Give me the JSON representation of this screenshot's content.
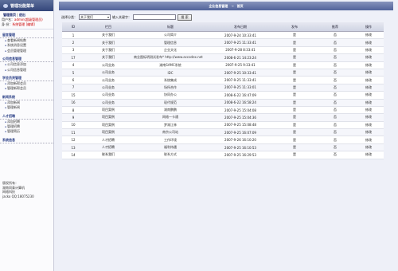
{
  "sidebar": {
    "title": "管理功能菜单",
    "top_links": [
      "管理首页",
      "退出"
    ],
    "user_label": "用户名：",
    "user_value": "admin(超级管理员)",
    "identity_label": "身 份：",
    "identity_value": "系统管理",
    "identity_extra": "[编辑]",
    "sections": [
      {
        "title": "留言管理",
        "items": [
          "查看新闻帖数",
          "系统消息设置",
          "会员管理管理"
        ]
      },
      {
        "title": "公司信息管理",
        "items": [
          "公司信息添加",
          "公司信息管理"
        ]
      },
      {
        "title": "学会员资管理",
        "items": [
          "添加新帮会员",
          "管理新帮会员"
        ]
      },
      {
        "title": "新闻系统",
        "items": [
          "添加新闻",
          "管理新闻"
        ]
      },
      {
        "title": "人才招聘",
        "items": [
          "添加招聘",
          "管理招聘",
          "管理简历"
        ]
      },
      {
        "title": "系统信息",
        "items": []
      }
    ],
    "footer": [
      "版权所有：",
      "湖南同泰计算机",
      "网络科技",
      "jacko QQ:18075230"
    ]
  },
  "header": {
    "title": "企业信息管理",
    "sep": "→",
    "current": "首页"
  },
  "search": {
    "label": "选择分类：",
    "category": "关于我们",
    "keyword_label": "输入关键字：",
    "keyword": "",
    "button": "搜 索"
  },
  "table": {
    "columns": [
      "ID",
      "栏目",
      "标题",
      "发布日期",
      "发布",
      "推荐",
      "操作"
    ],
    "rows": [
      [
        "1",
        "关于我们",
        "公司简介",
        "2007-9-24 10:33:41",
        "是",
        "否",
        "修改"
      ],
      [
        "2",
        "关于我们",
        "管理信息",
        "2007-9-25 11:33:41",
        "是",
        "否",
        "修改"
      ],
      [
        "3",
        "关于我们",
        "企业文化",
        "2007-9-28 8:33:41",
        "是",
        "否",
        "修改"
      ],
      [
        "17",
        "关于我们",
        "商业图标明测试发布* http://www.accodex.net",
        "2008-6-21 14:23:24",
        "是",
        "否",
        "修改"
      ],
      [
        "4",
        "公司业务",
        "湖南SAMC系统",
        "2007-9-25 9:33:41",
        "是",
        "否",
        "修改"
      ],
      [
        "5",
        "公司业务",
        "IDC",
        "2007-9-25 10:33:41",
        "是",
        "否",
        "修改"
      ],
      [
        "6",
        "公司业务",
        "系统集成",
        "2007-9-25 11:33:41",
        "是",
        "否",
        "修改"
      ],
      [
        "7",
        "公司业务",
        "场所合作",
        "2007-9-25 11:33:01",
        "是",
        "否",
        "修改"
      ],
      [
        "15",
        "公司业务",
        "协同办公",
        "2008-6-22 16:47:09",
        "是",
        "否",
        "修改"
      ],
      [
        "16",
        "公司业务",
        "现代规范",
        "2008-6-22 16:58:24",
        "是",
        "否",
        "修改"
      ],
      [
        "8",
        "项目案例",
        "湖南鹏鹏",
        "2007-9-25 15:04:08",
        "是",
        "否",
        "修改"
      ],
      [
        "9",
        "项目案例",
        "网络一卡通",
        "2007-9-25 15:04:36",
        "是",
        "否",
        "修改"
      ],
      [
        "10",
        "项目案例",
        "梦湖江林",
        "2007-9-25 15:08:48",
        "是",
        "否",
        "修改"
      ],
      [
        "11",
        "项目案例",
        "南京公司站",
        "2007-9-25 16:07:09",
        "是",
        "否",
        "修改"
      ],
      [
        "12",
        "人才招聘",
        "工作环境",
        "2007-9-26 16:10:20",
        "是",
        "否",
        "修改"
      ],
      [
        "13",
        "人才招聘",
        "福利待遇",
        "2007-9-25 16:10:53",
        "是",
        "否",
        "修改"
      ],
      [
        "14",
        "联系我们",
        "联系方式",
        "2007-9-25 16:29:53",
        "是",
        "否",
        "修改"
      ]
    ]
  }
}
